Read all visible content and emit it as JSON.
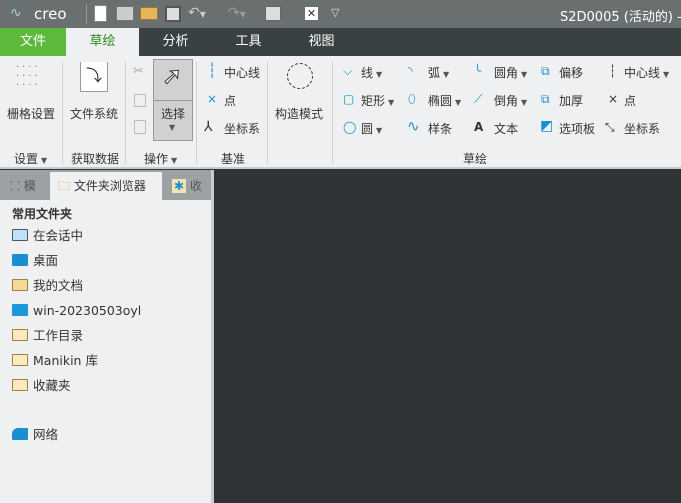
{
  "app": {
    "logo": "creo",
    "title": "S2D0005 (活动的) -"
  },
  "quick_access": [
    "new-icon",
    "print-icon",
    "open-icon",
    "save-icon",
    "undo-icon",
    "redo-icon",
    "windows-icon",
    "close-window-icon",
    "customize-icon"
  ],
  "tabs": [
    {
      "label": "文件"
    },
    {
      "label": "草绘"
    },
    {
      "label": "分析"
    },
    {
      "label": "工具"
    },
    {
      "label": "视图"
    }
  ],
  "ribbon": {
    "setup": {
      "button": "栅格设置",
      "group": "设置"
    },
    "get_data": {
      "button": "文件系统",
      "group": "获取数据"
    },
    "operations": {
      "select": "选择",
      "group": "操作"
    },
    "datum": {
      "centerline": "中心线",
      "point": "点",
      "csys": "坐标系",
      "group": "基准"
    },
    "construction": {
      "button": "构造模式"
    },
    "sketching": {
      "line": "线",
      "arc": "弧",
      "fillet": "圆角",
      "offset": "偏移",
      "centerline": "中心线",
      "rectangle": "矩形",
      "ellipse": "椭圆",
      "chamfer": "倒角",
      "thicken": "加厚",
      "point": "点",
      "circle": "圆",
      "spline": "样条",
      "text": "文本",
      "palette": "选项板",
      "csys": "坐标系",
      "group": "草绘"
    }
  },
  "panel": {
    "tabs": [
      {
        "label": "模"
      },
      {
        "label": "文件夹浏览器"
      },
      {
        "label": "收"
      }
    ],
    "heading": "常用文件夹",
    "items": [
      {
        "label": "在会话中"
      },
      {
        "label": "桌面"
      },
      {
        "label": "我的文档"
      },
      {
        "label": "win-20230503oyl"
      },
      {
        "label": "工作目录"
      },
      {
        "label": "Manikin 库"
      },
      {
        "label": "收藏夹"
      },
      {
        "label": "网络"
      }
    ]
  },
  "colors": {
    "file_tab": "#5cb93b",
    "accent": "#1a8fd0",
    "graphics_bg": "#2e3436"
  }
}
